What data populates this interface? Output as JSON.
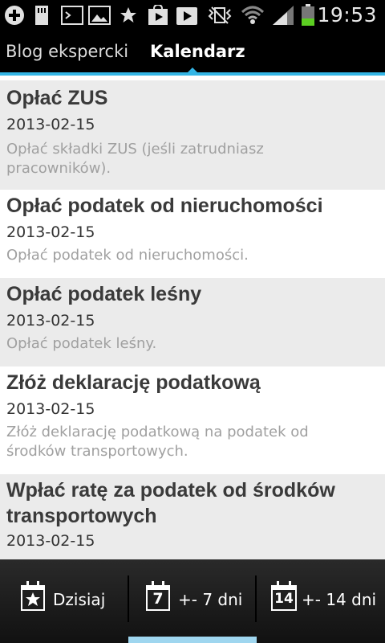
{
  "status_bar": {
    "time": "19:53",
    "icons": [
      "add-icon",
      "sd-card-icon",
      "terminal-icon",
      "image-icon",
      "star-icon",
      "play-store-icon",
      "play-icon",
      "no-vibrate-icon",
      "wifi-icon",
      "signal-icon",
      "battery-icon"
    ]
  },
  "tabs": [
    {
      "label": "Blog ekspercki"
    },
    {
      "label": "Kalendarz"
    }
  ],
  "items": [
    {
      "title": "Opłać ZUS",
      "date": "2013-02-15",
      "desc": "Opłać składki ZUS (jeśli zatrudniasz pracowników)."
    },
    {
      "title": "Opłać podatek od nieruchomości",
      "date": "2013-02-15",
      "desc": "Opłać podatek od nieruchomości."
    },
    {
      "title": "Opłać podatek leśny",
      "date": "2013-02-15",
      "desc": "Opłać podatek leśny."
    },
    {
      "title": "Złóż deklarację podatkową",
      "date": "2013-02-15",
      "desc": "Złóż deklarację podatkową na podatek od środków transportowych."
    },
    {
      "title": "Wpłać ratę za podatek od środków transportowych",
      "date": "2013-02-15"
    }
  ],
  "bottom_bar": {
    "today": {
      "label": "Dzisiaj",
      "icon": "calendar-star-icon"
    },
    "week": {
      "label": "+- 7 dni",
      "icon_number": "7"
    },
    "two_weeks": {
      "label": "+- 14 dni",
      "icon_number": "14"
    }
  },
  "colors": {
    "accent": "#33b5e5",
    "row_shaded": "#ebebeb",
    "selected_tab_underline": "#9fd6ef"
  }
}
